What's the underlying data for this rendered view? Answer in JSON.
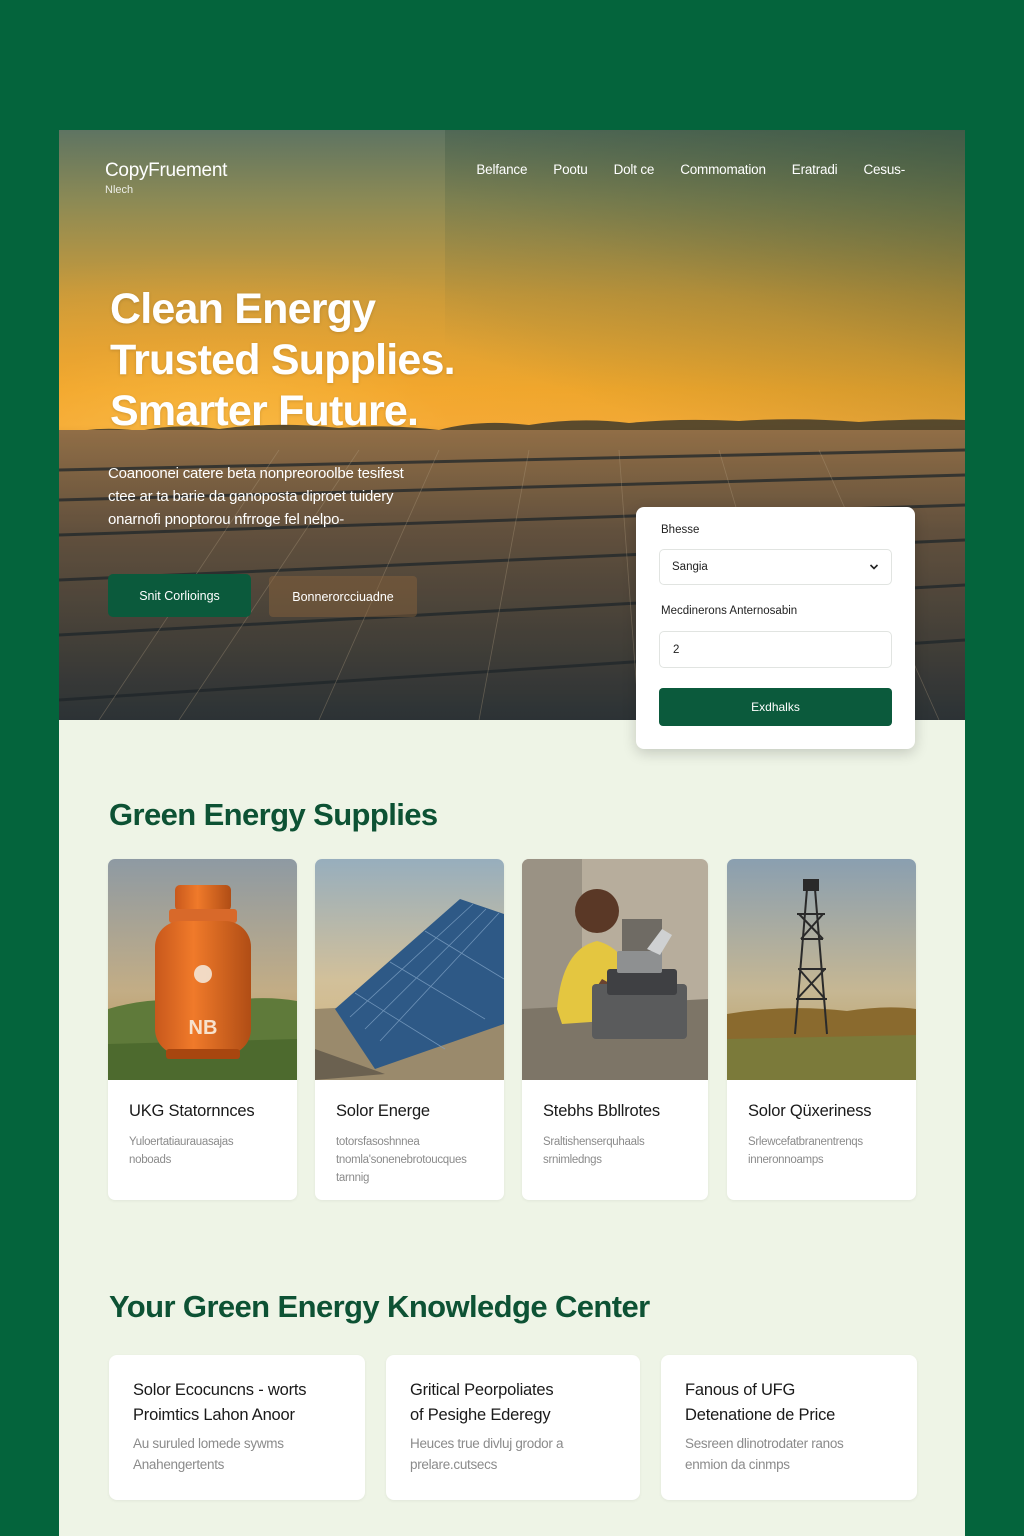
{
  "brand": {
    "name": "CopyFruement",
    "tagline": "Nlech"
  },
  "nav": {
    "items": [
      "Belfance",
      "Pootu",
      "Dolt ce",
      "Commomation",
      "Eratradi",
      "Cesus-"
    ]
  },
  "hero": {
    "title_lines": [
      "Clean Energy",
      "Trusted Supplies.",
      "Smarter Future."
    ],
    "description_lines": [
      "Coanoonei catere beta nonpreoroolbe tesifest",
      "ctee ar ta barie da ganoposta diproet tuidery",
      "onarnofi pnoptorou nfrroge fel nelpo-"
    ],
    "primary_button": "Snit Corlioings",
    "secondary_button": "Bonnerorcciuadne"
  },
  "quote_form": {
    "select_label": "Bhesse",
    "select_value": "Sangia",
    "input_label": "Mecdinerons Anternosabin",
    "input_value": "2",
    "submit_label": "Exdhalks"
  },
  "supplies": {
    "heading": "Green Energy Supplies",
    "cards": [
      {
        "title": "UKG Statornnces",
        "description_lines": [
          "Yuloertatiaurauasajas",
          "noboads"
        ],
        "image_label": "NB"
      },
      {
        "title": "Solor Energe",
        "description_lines": [
          "totorsfasoshnnea",
          "tnomla'sonenebrotoucques",
          "tarnnig"
        ]
      },
      {
        "title": "Stebhs Bbllrotes",
        "description_lines": [
          "Sraltishenserquhaals",
          "srnimledngs"
        ]
      },
      {
        "title": "Solor Qüxeriness",
        "description_lines": [
          "Srlewcefatbranentrenqs",
          "inneronnoamps"
        ]
      }
    ]
  },
  "knowledge": {
    "heading": "Your Green Energy Knowledge Center",
    "cards": [
      {
        "title_lines": [
          "Solor Ecocuncns - worts",
          "Proimtics Lahon Anoor"
        ],
        "description_lines": [
          "Au suruled lomede sywms",
          "Anahengertents"
        ]
      },
      {
        "title_lines": [
          "Gritical Peorpoliates",
          "of Pesighe Ederegy"
        ],
        "description_lines": [
          "Heuces true divluj grodor a",
          "prelare.cutsecs"
        ]
      },
      {
        "title_lines": [
          "Fanous of UFG",
          "Detenatione de Price"
        ],
        "description_lines": [
          "Sesreen dlinotrodater ranos",
          "enmion da cinmps"
        ]
      }
    ]
  },
  "colors": {
    "brand_green": "#0b5a3c",
    "heading_green": "#0d5234",
    "frame": "#04643c",
    "background": "#eef4e6"
  }
}
